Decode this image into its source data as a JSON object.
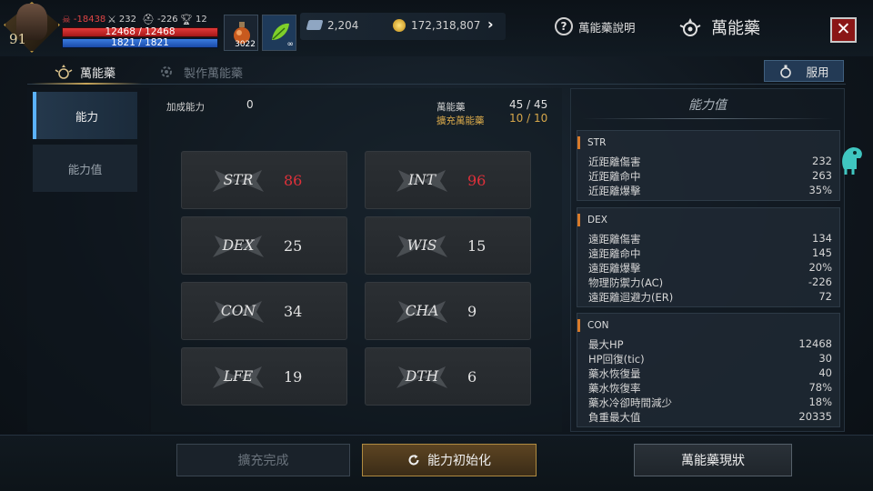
{
  "player": {
    "level": "91",
    "pk_value": "-18438",
    "attack": "232",
    "defense": "-226",
    "trophy": "12",
    "hp_text": "12468 / 12468",
    "mp_text": "1821 / 1821",
    "hp_fraction": 1.0,
    "mp_fraction": 1.0
  },
  "slots": {
    "potion_count": "3022",
    "leaf_count": "∞"
  },
  "resources": {
    "tickets": "2,204",
    "gold": "172,318,807"
  },
  "header": {
    "help_label": "萬能藥說明",
    "title": "萬能藥",
    "close_symbol": "✕"
  },
  "tabs": [
    {
      "label": "萬能藥",
      "active": true
    },
    {
      "label": "製作萬能藥",
      "active": false
    }
  ],
  "use_button": {
    "label": "服用"
  },
  "left_menu": [
    {
      "label": "能力",
      "active": true
    },
    {
      "label": "能力值",
      "active": false
    }
  ],
  "summary": {
    "bonus_label": "加成能力",
    "bonus_value": "0",
    "panacea_label": "萬能藥",
    "panacea_value": "45 / 45",
    "extended_label": "擴充萬能藥",
    "extended_value": "10 / 10"
  },
  "stats": [
    {
      "name": "STR",
      "value": "86",
      "highlight": true
    },
    {
      "name": "INT",
      "value": "96",
      "highlight": true
    },
    {
      "name": "DEX",
      "value": "25",
      "highlight": false
    },
    {
      "name": "WIS",
      "value": "15",
      "highlight": false
    },
    {
      "name": "CON",
      "value": "34",
      "highlight": false
    },
    {
      "name": "CHA",
      "value": "9",
      "highlight": false
    },
    {
      "name": "LFE",
      "value": "19",
      "highlight": false
    },
    {
      "name": "DTH",
      "value": "6",
      "highlight": false
    }
  ],
  "ability_panel": {
    "title": "能力值",
    "groups": [
      {
        "name": "STR",
        "rows": [
          {
            "label": "近距離傷害",
            "value": "232"
          },
          {
            "label": "近距離命中",
            "value": "263"
          },
          {
            "label": "近距離爆擊",
            "value": "35%"
          }
        ]
      },
      {
        "name": "DEX",
        "rows": [
          {
            "label": "遠距離傷害",
            "value": "134"
          },
          {
            "label": "遠距離命中",
            "value": "145"
          },
          {
            "label": "遠距離爆擊",
            "value": "20%"
          },
          {
            "label": "物理防禦力(AC)",
            "value": "-226"
          },
          {
            "label": "遠距離迴避力(ER)",
            "value": "72"
          }
        ]
      },
      {
        "name": "CON",
        "rows": [
          {
            "label": "最大HP",
            "value": "12468"
          },
          {
            "label": "HP回復(tic)",
            "value": "30"
          },
          {
            "label": "藥水恢復量",
            "value": "40"
          },
          {
            "label": "藥水恢復率",
            "value": "78%"
          },
          {
            "label": "藥水冷卻時間減少",
            "value": "18%"
          },
          {
            "label": "負重最大值",
            "value": "20335"
          }
        ]
      }
    ]
  },
  "bottom": {
    "expand_label": "擴充完成",
    "reset_label": "能力初始化",
    "status_label": "萬能藥現狀"
  },
  "colors": {
    "highlight_red": "#e0303a",
    "accent_gold": "#d6a74a",
    "group_marker": "#d77a2a"
  }
}
